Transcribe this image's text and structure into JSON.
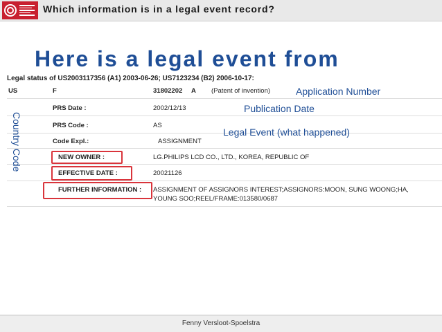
{
  "header": {
    "title": "Which information is in a legal event record?"
  },
  "slide": {
    "headline": "Here is a legal event from",
    "legal_status": "Legal status of US2003117356 (A1) 2003-06-26; US7123234 (B2) 2006-10-17:"
  },
  "record": {
    "country": "US",
    "kind": "F",
    "number": "31802202",
    "number_kind": "A",
    "patent_type": "(Patent of invention)",
    "fields": [
      {
        "label": "PRS Date :",
        "value": "2002/12/13"
      },
      {
        "label": "PRS Code :",
        "value": "AS"
      },
      {
        "label": "Code Expl.:",
        "value": "ASSIGNMENT"
      },
      {
        "label": "NEW OWNER :",
        "value": "LG.PHILIPS LCD CO., LTD., KOREA, REPUBLIC OF"
      },
      {
        "label": "EFFECTIVE DATE :",
        "value": "20021126"
      },
      {
        "label": "FURTHER INFORMATION :",
        "value_line1": "ASSIGNMENT OF ASSIGNORS INTEREST;ASSIGNORS:MOON, SUNG WOONG;HA,",
        "value_line2": "YOUNG SOO;REEL/FRAME:013580/0687"
      }
    ]
  },
  "callouts": {
    "application_number": "Application Number",
    "publication_date": "Publication Date",
    "legal_event": "Legal Event (what happened)",
    "country_code": "Country Code",
    "glyph": ""
  },
  "footer": {
    "author": "Fenny Versloot-Spoelstra"
  },
  "colors": {
    "accent": "#1f4e96",
    "logo_red": "#c8202f",
    "highlight_red": "#d9343b"
  }
}
